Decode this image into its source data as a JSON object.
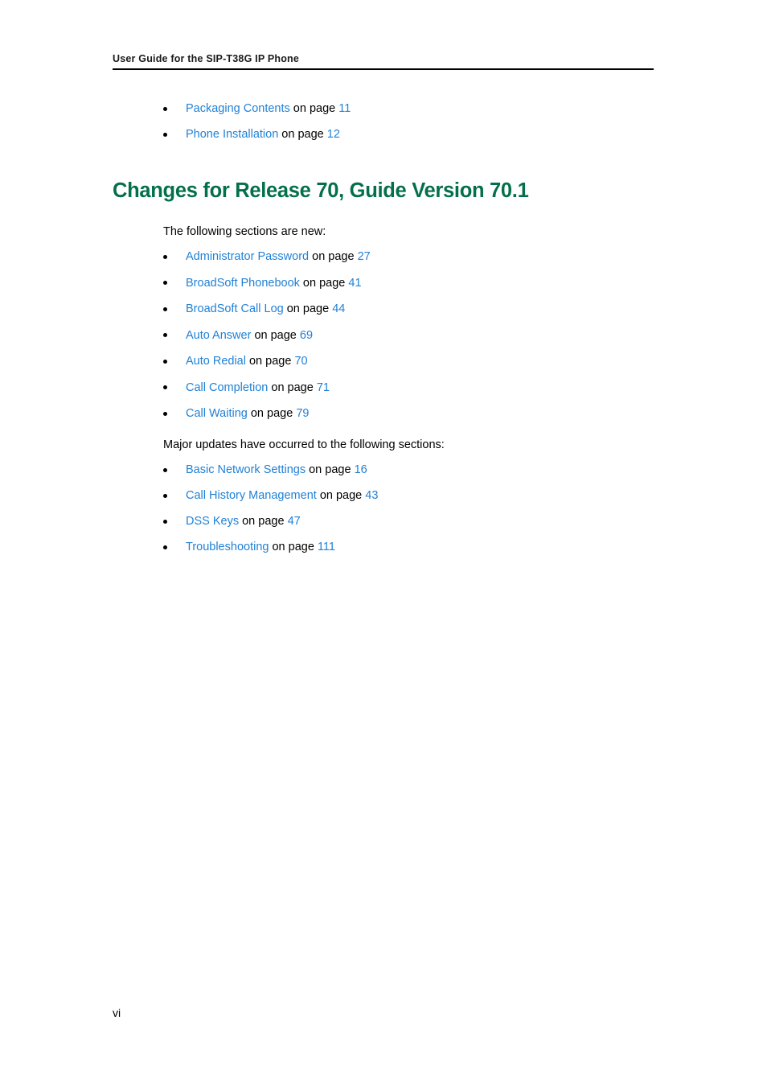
{
  "header": {
    "running_title": "User Guide for the SIP-T38G IP Phone"
  },
  "intro_list": [
    {
      "link": "Packaging Contents",
      "connector": " on page ",
      "page": "11"
    },
    {
      "link": "Phone Installation",
      "connector": " on page ",
      "page": "12"
    }
  ],
  "section": {
    "heading": "Changes for Release 70, Guide Version 70.1",
    "new_intro": "The following sections are new:",
    "updates_intro": "Major updates have occurred to the following sections:"
  },
  "new_sections_list": [
    {
      "link": "Administrator Password",
      "connector": " on page ",
      "page": "27"
    },
    {
      "link": "BroadSoft Phonebook",
      "connector": " on page ",
      "page": "41"
    },
    {
      "link": "BroadSoft Call Log",
      "connector": " on page ",
      "page": "44"
    },
    {
      "link": "Auto Answer",
      "connector": " on page ",
      "page": "69"
    },
    {
      "link": "Auto Redial",
      "connector": " on page ",
      "page": "70"
    },
    {
      "link": "Call Completion",
      "connector": " on page ",
      "page": "71"
    },
    {
      "link": "Call Waiting",
      "connector": " on page ",
      "page": "79"
    }
  ],
  "updated_sections_list": [
    {
      "link": "Basic Network Settings",
      "connector": " on page ",
      "page": "16"
    },
    {
      "link": "Call History Management",
      "connector": " on page ",
      "page": "43"
    },
    {
      "link": "DSS Keys",
      "connector": " on page ",
      "page": "47"
    },
    {
      "link": "Troubleshooting",
      "connector": " on page ",
      "page": "111"
    }
  ],
  "footer": {
    "folio": "vi"
  },
  "colors": {
    "link": "#2181d6",
    "heading": "#04704a",
    "body": "#000000",
    "rule": "#000000",
    "background": "#ffffff"
  }
}
